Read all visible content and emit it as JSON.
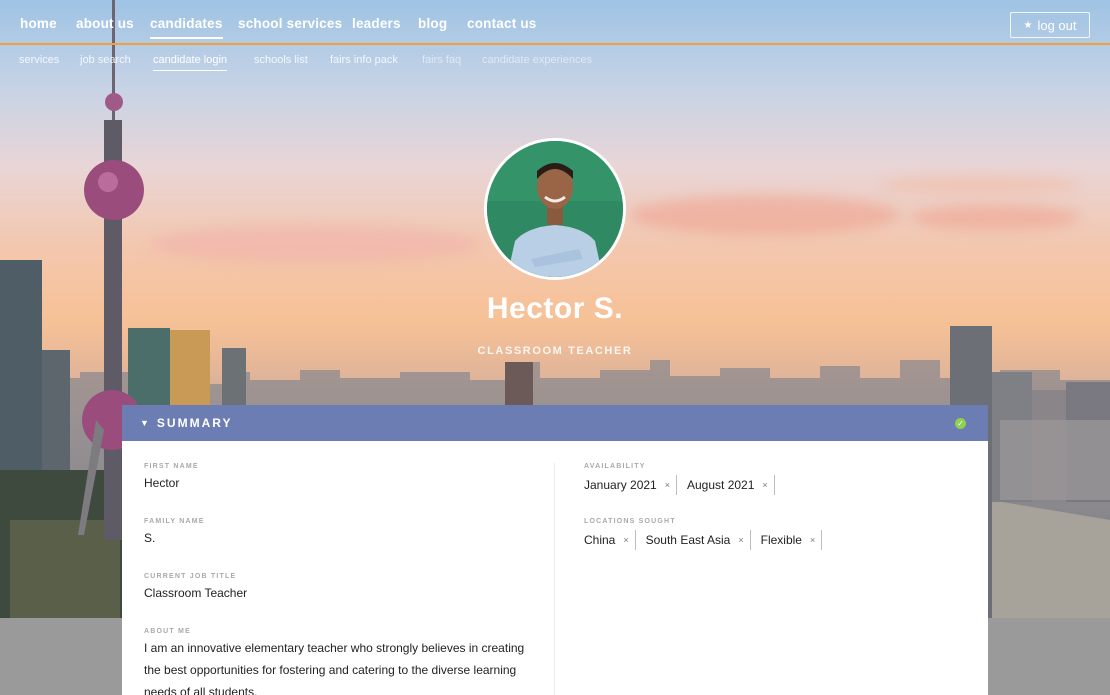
{
  "nav": {
    "items": [
      {
        "label": "home"
      },
      {
        "label": "about us"
      },
      {
        "label": "candidates"
      },
      {
        "label": "school services"
      },
      {
        "label": "leaders"
      },
      {
        "label": "blog"
      },
      {
        "label": "contact us"
      }
    ],
    "logout_icon": "star-icon",
    "logout_label": "log out",
    "accent_color": "#f2a03c"
  },
  "subnav": {
    "items": [
      {
        "label": "services"
      },
      {
        "label": "job search"
      },
      {
        "label": "candidate login"
      },
      {
        "label": "schools list"
      },
      {
        "label": "fairs info pack"
      },
      {
        "label": "fairs faq"
      },
      {
        "label": "candidate experiences"
      }
    ]
  },
  "profile": {
    "name": "Hector S.",
    "role": "CLASSROOM TEACHER"
  },
  "summary": {
    "title": "SUMMARY",
    "header_color": "#6c7db4",
    "status_icon": "check-circle-icon",
    "left": {
      "first_name_label": "FIRST NAME",
      "first_name": "Hector",
      "family_name_label": "FAMILY NAME",
      "family_name": "S.",
      "job_title_label": "CURRENT JOB TITLE",
      "job_title": "Classroom Teacher",
      "about_label": "ABOUT ME",
      "about": "I am an innovative elementary teacher who strongly believes in creating the best opportunities for fostering and catering to the diverse learning needs of all students."
    },
    "right": {
      "availability_label": "AVAILABILITY",
      "availability": [
        "January 2021",
        "August 2021"
      ],
      "locations_label": "LOCATIONS SOUGHT",
      "locations": [
        "China",
        "South East Asia",
        "Flexible"
      ]
    }
  }
}
